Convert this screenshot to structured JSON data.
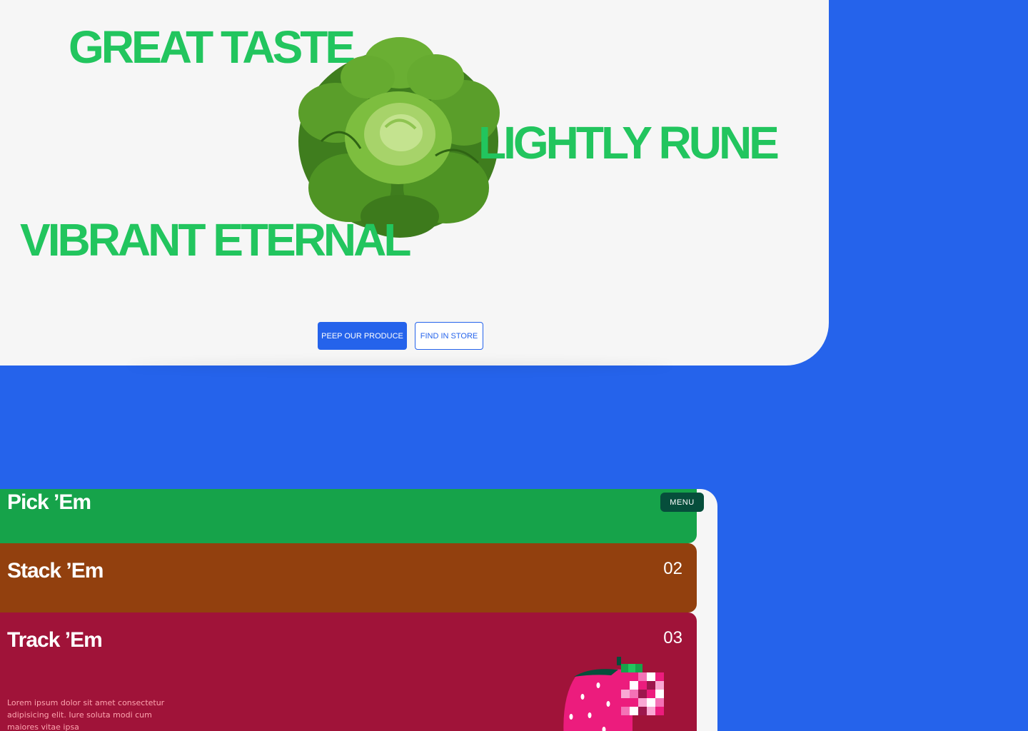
{
  "hero": {
    "headline_1": "GREAT TASTE",
    "headline_2": "LIGHTLY RUNE",
    "headline_3": "VIBRANT ETERNAL",
    "primary_button": "PEEP OUR PRODUCE",
    "secondary_button": "FIND IN STORE"
  },
  "nav": {
    "menu_label": "MENU"
  },
  "cards": [
    {
      "title": "Pick ’Em",
      "number": "",
      "color": "#16a34a"
    },
    {
      "title": "Stack ’Em",
      "number": "02",
      "color": "#92400e"
    },
    {
      "title": "Track ’Em",
      "number": "03",
      "color": "#a01339",
      "description": "Lorem ipsum dolor sit amet consectetur adipisicing elit. Iure soluta modi cum maiores vitae ipsa"
    }
  ],
  "colors": {
    "background": "#2563eb",
    "headline": "#22c55e",
    "panel": "#f6f6f6"
  },
  "icons": {
    "hero_image": "lettuce-image",
    "card_image": "strawberry-image"
  }
}
